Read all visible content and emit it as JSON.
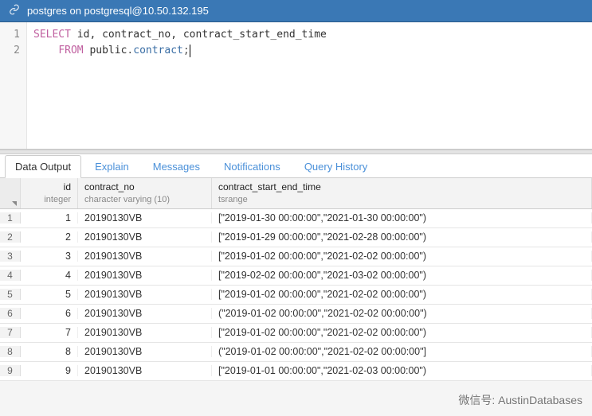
{
  "connection": {
    "title": "postgres on postgresql@10.50.132.195"
  },
  "editor": {
    "lines": [
      "1",
      "2"
    ],
    "sql_line1_kw": "SELECT",
    "sql_line1_rest": " id, contract_no, contract_start_end_time",
    "sql_line2_indent": "    ",
    "sql_line2_kw": "FROM",
    "sql_line2_schema": " public",
    "sql_line2_dot": ".",
    "sql_line2_table": "contract",
    "sql_line2_semi": ";"
  },
  "tabs": {
    "data_output": "Data Output",
    "explain": "Explain",
    "messages": "Messages",
    "notifications": "Notifications",
    "query_history": "Query History"
  },
  "grid": {
    "columns": {
      "id": {
        "name": "id",
        "type": "integer"
      },
      "cn": {
        "name": "contract_no",
        "type": "character varying (10)"
      },
      "ts": {
        "name": "contract_start_end_time",
        "type": "tsrange"
      }
    },
    "rows": [
      {
        "n": "1",
        "id": "1",
        "cn": "20190130VB",
        "ts": "[\"2019-01-30 00:00:00\",\"2021-01-30 00:00:00\")"
      },
      {
        "n": "2",
        "id": "2",
        "cn": "20190130VB",
        "ts": "[\"2019-01-29 00:00:00\",\"2021-02-28 00:00:00\")"
      },
      {
        "n": "3",
        "id": "3",
        "cn": "20190130VB",
        "ts": "[\"2019-01-02 00:00:00\",\"2021-02-02 00:00:00\")"
      },
      {
        "n": "4",
        "id": "4",
        "cn": "20190130VB",
        "ts": "[\"2019-02-02 00:00:00\",\"2021-03-02 00:00:00\")"
      },
      {
        "n": "5",
        "id": "5",
        "cn": "20190130VB",
        "ts": "[\"2019-01-02 00:00:00\",\"2021-02-02 00:00:00\")"
      },
      {
        "n": "6",
        "id": "6",
        "cn": "20190130VB",
        "ts": "(\"2019-01-02 00:00:00\",\"2021-02-02 00:00:00\")"
      },
      {
        "n": "7",
        "id": "7",
        "cn": "20190130VB",
        "ts": "[\"2019-01-02 00:00:00\",\"2021-02-02 00:00:00\")"
      },
      {
        "n": "8",
        "id": "8",
        "cn": "20190130VB",
        "ts": "(\"2019-01-02 00:00:00\",\"2021-02-02 00:00:00\"]"
      },
      {
        "n": "9",
        "id": "9",
        "cn": "20190130VB",
        "ts": "[\"2019-01-01 00:00:00\",\"2021-02-03 00:00:00\")"
      }
    ]
  },
  "watermark": "微信号: AustinDatabases"
}
